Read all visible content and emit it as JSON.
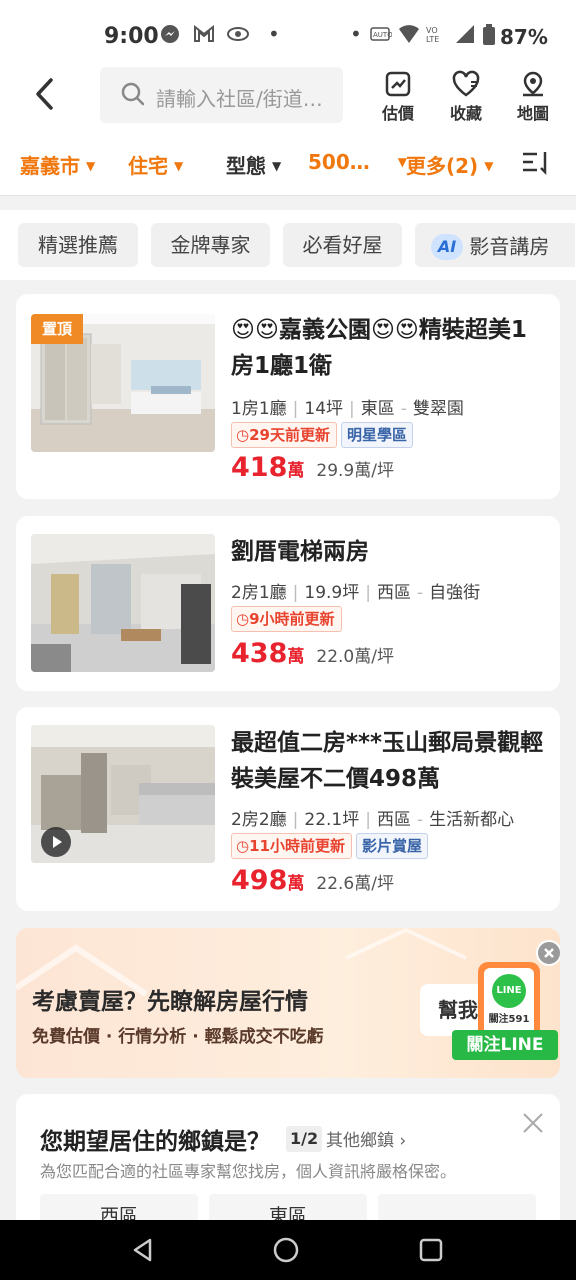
{
  "status": {
    "time": "9:00",
    "battery": "87%"
  },
  "header": {
    "search_placeholder": "請輸入社區/街道…",
    "actions": [
      {
        "label": "估價"
      },
      {
        "label": "收藏"
      },
      {
        "label": "地圖"
      }
    ]
  },
  "filters": {
    "city": "嘉義市",
    "type": "住宅",
    "layout": "型態",
    "price": "500…",
    "more": "更多(2)"
  },
  "tags": [
    "精選推薦",
    "金牌專家",
    "必看好屋",
    "影音講房"
  ],
  "ai_label": "AI",
  "listings": [
    {
      "badge": "置頂",
      "title": "😍😍嘉義公園😍😍精裝超美1房1廳1衛",
      "rooms": "1房1廳",
      "size": "14坪",
      "district": "東區",
      "street": "雙翠園",
      "updated": "29天前更新",
      "extra_tag": "明星學區",
      "price": "418",
      "price_unit": "萬",
      "price_per_ping": "29.9萬/坪"
    },
    {
      "title": "劉厝電梯兩房",
      "rooms": "2房1廳",
      "size": "19.9坪",
      "district": "西區",
      "street": "自強街",
      "updated": "9小時前更新",
      "price": "438",
      "price_unit": "萬",
      "price_per_ping": "22.0萬/坪"
    },
    {
      "title": "最超值二房***玉山郵局景觀輕裝美屋不二價498萬",
      "rooms": "2房2廳",
      "size": "22.1坪",
      "district": "西區",
      "street": "生活新都心",
      "updated": "11小時前更新",
      "extra_tag": "影片賞屋",
      "price": "498",
      "price_unit": "萬",
      "price_per_ping": "22.6萬/坪"
    }
  ],
  "promo": {
    "title": "考慮賣屋？先瞭解房屋行情",
    "subtitle": "免費估價 · 行情分析 · 輕鬆成交不吃虧",
    "help": "幫我",
    "line_logo": "LINE",
    "follow_text": "關注591",
    "line_button": "關注LINE"
  },
  "survey": {
    "title": "您期望居住的鄉鎮是？",
    "page": "1/2",
    "other": "其他鄉鎮",
    "subtitle": "為您匹配合適的社區專家幫您找房，個人資訊將嚴格保密。",
    "options": [
      "西區",
      "東區",
      ""
    ]
  },
  "colors": {
    "accent": "#f0780f",
    "price": "#e8232e",
    "line": "#27b846"
  }
}
